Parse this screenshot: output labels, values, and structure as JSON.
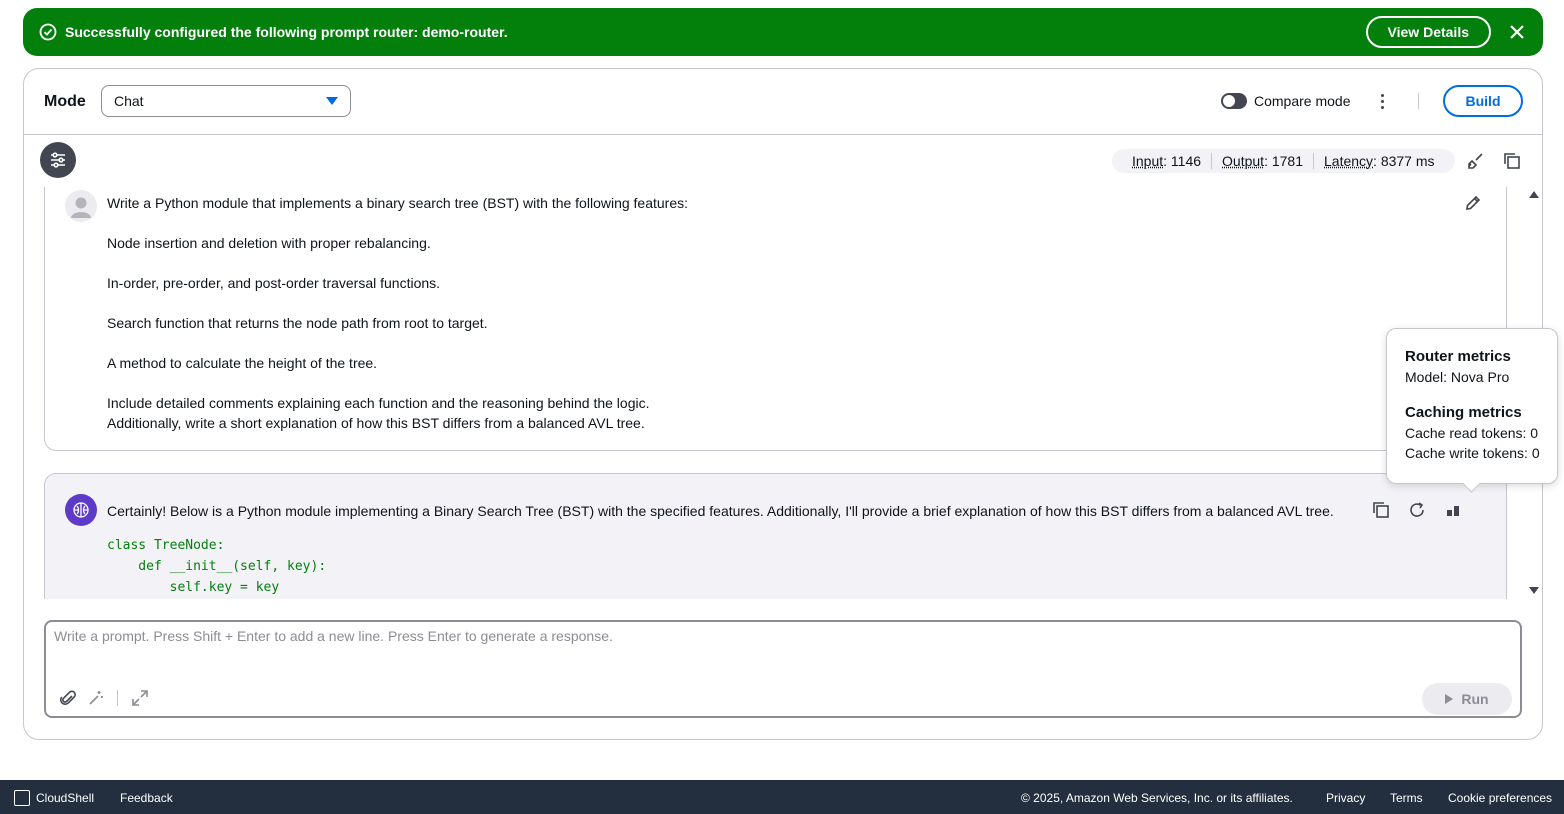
{
  "flash": {
    "message": "Successfully configured the following prompt router: demo-router.",
    "view_details_label": "View Details",
    "close_icon": "close-icon",
    "status_icon": "check-circle-icon",
    "color": "#037f0c"
  },
  "header": {
    "mode_label": "Mode",
    "mode_value": "Chat",
    "compare_mode_label": "Compare mode",
    "compare_mode_on": false,
    "build_label": "Build"
  },
  "metrics": {
    "input_label": "Input",
    "input_value": ": 1146",
    "output_label": "Output",
    "output_value": ": 1781",
    "latency_label": "Latency",
    "latency_value": ": 8377 ms"
  },
  "conversation": {
    "user": {
      "lines": [
        "Write a Python module that implements a binary search tree (BST) with the following features:",
        "Node insertion and deletion with proper rebalancing.",
        "In-order, pre-order, and post-order traversal functions.",
        "Search function that returns the node path from root to target.",
        "A method to calculate the height of the tree.",
        "Include detailed comments explaining each function and the reasoning behind the logic.",
        "Additionally, write a short explanation of how this BST differs from a balanced AVL tree."
      ]
    },
    "assistant": {
      "text": "Certainly! Below is a Python module implementing a Binary Search Tree (BST) with the specified features. Additionally, I'll provide a brief explanation of how this BST differs from a balanced AVL tree.",
      "code_lines": [
        "class TreeNode:",
        "    def __init__(self, key):",
        "        self.key = key"
      ]
    }
  },
  "popover": {
    "router_title": "Router metrics",
    "model": "Model: Nova Pro",
    "caching_title": "Caching metrics",
    "cache_read": "Cache read tokens: 0",
    "cache_write": "Cache write tokens: 0"
  },
  "prompt": {
    "placeholder": "Write a prompt. Press Shift + Enter to add a new line. Press Enter to generate a response.",
    "run_label": "Run"
  },
  "footer": {
    "cloudshell": "CloudShell",
    "feedback": "Feedback",
    "copyright": "© 2025, Amazon Web Services, Inc. or its affiliates.",
    "privacy": "Privacy",
    "terms": "Terms",
    "cookie": "Cookie preferences"
  }
}
